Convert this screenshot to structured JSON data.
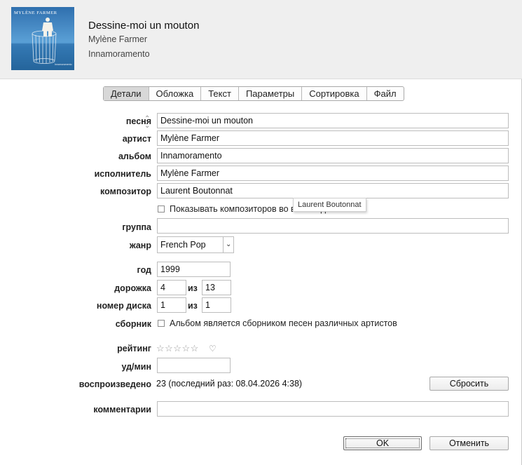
{
  "header": {
    "album_art_text": "MYLÈNE FARMER",
    "title": "Dessine-moi un mouton",
    "artist": "Mylène Farmer",
    "album": "Innamoramento"
  },
  "tabs": [
    {
      "label": "Детали",
      "active": true
    },
    {
      "label": "Обложка",
      "active": false
    },
    {
      "label": "Текст",
      "active": false
    },
    {
      "label": "Параметры",
      "active": false
    },
    {
      "label": "Сортировка",
      "active": false
    },
    {
      "label": "Файл",
      "active": false
    }
  ],
  "fields": {
    "song": {
      "label": "песня",
      "value": "Dessine-moi un mouton"
    },
    "artist": {
      "label": "артист",
      "value": "Mylène Farmer"
    },
    "album": {
      "label": "альбом",
      "value": "Innamoramento"
    },
    "album_artist": {
      "label": "исполнитель",
      "value": "Mylène Farmer"
    },
    "composer": {
      "label": "композитор",
      "value": "Laurent Boutonnat"
    },
    "show_composers": {
      "label": "Показывать композиторов во всех видах",
      "checked": false
    },
    "tooltip": "Laurent Boutonnat",
    "grouping": {
      "label": "группа",
      "value": ""
    },
    "genre": {
      "label": "жанр",
      "value": "French Pop"
    },
    "year": {
      "label": "год",
      "value": "1999"
    },
    "track": {
      "label": "дорожка",
      "number": "4",
      "of_label": "из",
      "total": "13"
    },
    "disc": {
      "label": "номер диска",
      "number": "1",
      "of_label": "из",
      "total": "1"
    },
    "compilation": {
      "label": "сборник",
      "text": "Альбом является сборником песен различных артистов",
      "checked": false
    },
    "rating": {
      "label": "рейтинг",
      "stars": "☆☆☆☆☆",
      "value": 0,
      "heart": "♡"
    },
    "bpm": {
      "label": "уд/мин",
      "value": ""
    },
    "plays": {
      "label": "воспроизведено",
      "value": "23 (последний раз: 08.04.2026 4:38)",
      "reset_label": "Сбросить"
    },
    "comments": {
      "label": "комментарии",
      "value": ""
    }
  },
  "buttons": {
    "ok": "OK",
    "cancel": "Отменить"
  },
  "colors": {
    "header_bg": "#efefef",
    "active_tab_bg": "#d8d8d8",
    "art_sky": "#3f86c4",
    "art_sea": "#2a6ea6"
  }
}
